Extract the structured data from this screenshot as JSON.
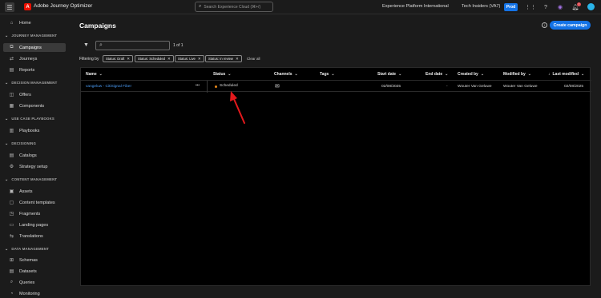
{
  "topbar": {
    "app_title": "Adobe Journey Optimizer",
    "logo_letter": "A",
    "search_placeholder": "Search Experience Cloud (⌘+/)",
    "org": "Experience Platform International",
    "sandbox": "Tech Insiders (VA7)",
    "env_badge": "Prod",
    "notification_count": "7"
  },
  "sidebar": {
    "home": "Home",
    "sections": [
      {
        "title": "JOURNEY MANAGEMENT",
        "items": [
          "Campaigns",
          "Journeys",
          "Reports"
        ]
      },
      {
        "title": "DECISION MANAGEMENT",
        "items": [
          "Offers",
          "Components"
        ]
      },
      {
        "title": "USE CASE PLAYBOOKS",
        "items": [
          "Playbooks"
        ]
      },
      {
        "title": "DECISIONING",
        "items": [
          "Catalogs",
          "Strategy setup"
        ]
      },
      {
        "title": "CONTENT MANAGEMENT",
        "items": [
          "Assets",
          "Content templates",
          "Fragments",
          "Landing pages",
          "Translations"
        ]
      },
      {
        "title": "DATA MANAGEMENT",
        "items": [
          "Schemas",
          "Datasets",
          "Queries",
          "Monitoring"
        ]
      }
    ],
    "active_item": "Campaigns"
  },
  "main": {
    "title": "Campaigns",
    "create_label": "Create campaign",
    "result_count": "1 of 1",
    "filtering_label": "Filtering by",
    "chips": [
      "Status: Draft",
      "Status: Scheduled",
      "Status: Live",
      "Status: In review"
    ],
    "clear_all": "Clear all",
    "columns": [
      "Name",
      "Status",
      "Channels",
      "Tags",
      "Start date",
      "End date",
      "Created by",
      "Modified by",
      "Last modified"
    ],
    "rows": [
      {
        "name": "vangeluw - CitiSignal Fiber",
        "more": "•••",
        "status": "Scheduled",
        "channel": "email",
        "start_date": "02/08/2025",
        "end_date": "-",
        "created_by": "Wouter Van Geluwe",
        "modified_by": "Wouter Van Geluwe",
        "last_modified": "02/08/2025"
      }
    ]
  },
  "colors": {
    "accent": "#1473e6",
    "status_scheduled": "#e68619",
    "annotation_arrow": "#e3191c",
    "link": "#4b9cf5"
  }
}
